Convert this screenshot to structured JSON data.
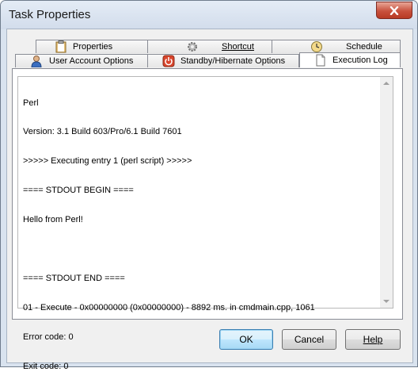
{
  "window": {
    "title": "Task Properties"
  },
  "tabs_back_row": [
    {
      "label": "Properties",
      "icon": "clipboard-icon"
    },
    {
      "label": "Shortcut",
      "icon": "gear-icon"
    },
    {
      "label": "Schedule",
      "icon": "clock-icon"
    }
  ],
  "tabs_front_row": [
    {
      "label": "User Account Options",
      "icon": "user-icon"
    },
    {
      "label": "Standby/Hibernate Options",
      "icon": "power-icon"
    },
    {
      "label": "Execution Log",
      "icon": "document-icon",
      "active": true
    }
  ],
  "log": {
    "lines": [
      "Perl",
      "Version: 3.1 Build 603/Pro/6.1 Build 7601",
      ">>>>> Executing entry 1 (perl script) >>>>>",
      "==== STDOUT BEGIN ====",
      "Hello from Perl!",
      "",
      "==== STDOUT END ====",
      "01 - Execute - 0x00000000 (0x00000000) - 8892 ms. in cmdmain.cpp, 1061",
      "Error code: 0",
      "Exit code: 0"
    ]
  },
  "buttons": {
    "ok": "OK",
    "cancel": "Cancel",
    "help": "Help"
  },
  "colors": {
    "title_bg": "#d9e3ef",
    "close": "#c8513d",
    "default_button": "#bee6fd"
  }
}
